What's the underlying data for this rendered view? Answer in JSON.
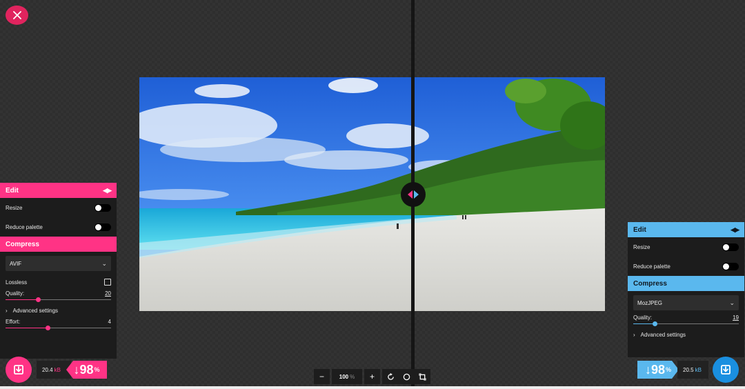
{
  "close": {
    "icon": "close-icon"
  },
  "left_panel": {
    "edit_title": "Edit",
    "resize_label": "Resize",
    "reduce_palette_label": "Reduce palette",
    "compress_title": "Compress",
    "codec": "AVIF",
    "lossless_label": "Lossless",
    "quality_label": "Quality:",
    "quality_value": "20",
    "quality_fraction": 0.31,
    "advanced_label": "Advanced settings",
    "effort_label": "Effort:",
    "effort_value": "4",
    "effort_fraction": 0.4,
    "accent": "#ff3385"
  },
  "right_panel": {
    "edit_title": "Edit",
    "resize_label": "Resize",
    "reduce_palette_label": "Reduce palette",
    "compress_title": "Compress",
    "codec": "MozJPEG",
    "quality_label": "Quality:",
    "quality_value": "19",
    "quality_fraction": 0.2,
    "advanced_label": "Advanced settings",
    "accent": "#5ab8ee"
  },
  "left_result": {
    "size": "20.4",
    "unit": "kB",
    "percent": "↓98",
    "percent_sym": "%"
  },
  "right_result": {
    "size": "20.5",
    "unit": "kB",
    "percent": "↓98",
    "percent_sym": "%"
  },
  "zoom": {
    "minus": "−",
    "value": "100",
    "unit": "%",
    "plus": "+"
  }
}
